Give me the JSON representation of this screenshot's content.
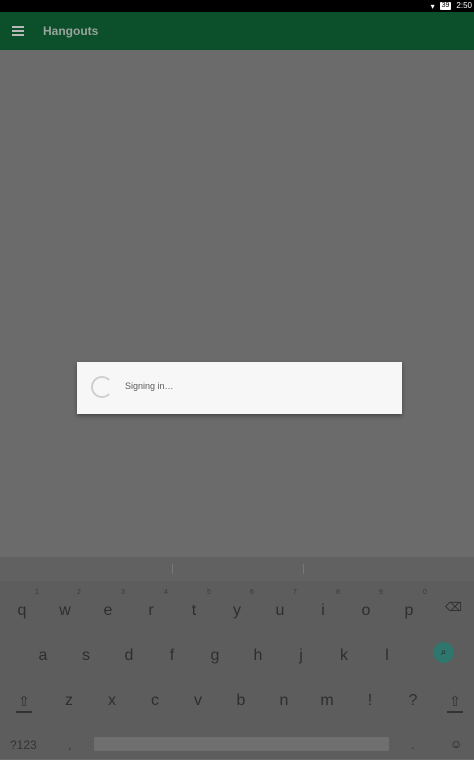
{
  "status": {
    "battery": "39",
    "time": "2:50"
  },
  "app": {
    "title": "Hangouts"
  },
  "dialog": {
    "message": "Signing in…"
  },
  "keyboard": {
    "row1": [
      "q",
      "w",
      "e",
      "r",
      "t",
      "y",
      "u",
      "i",
      "o",
      "p"
    ],
    "row1_hints": [
      "1",
      "2",
      "3",
      "4",
      "5",
      "6",
      "7",
      "8",
      "9",
      "0"
    ],
    "row2": [
      "a",
      "s",
      "d",
      "f",
      "g",
      "h",
      "j",
      "k",
      "l"
    ],
    "row3": [
      "z",
      "x",
      "c",
      "v",
      "b",
      "n",
      "m",
      "!",
      "?"
    ],
    "symbols_label": "?123",
    "comma": ",",
    "period": "."
  }
}
